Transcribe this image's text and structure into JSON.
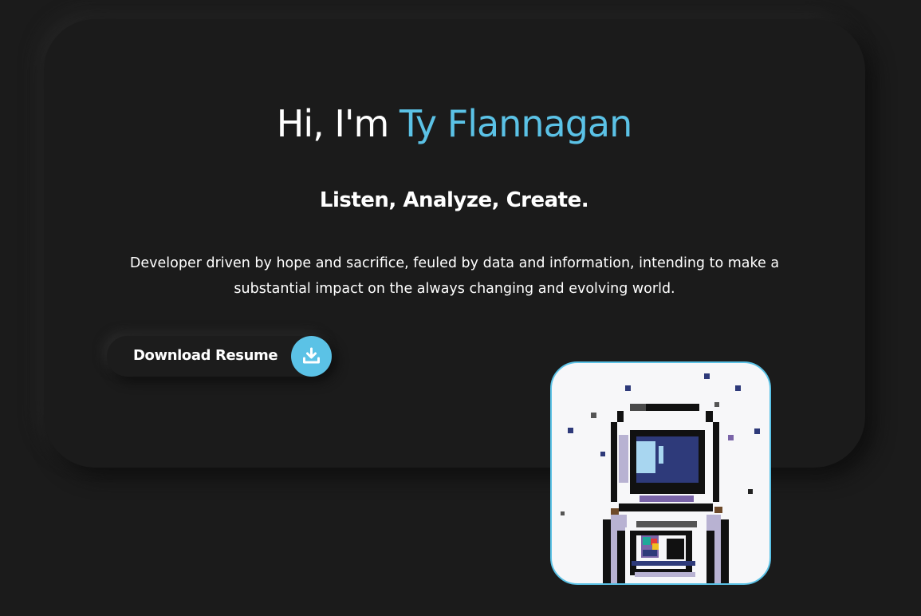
{
  "hero": {
    "greeting": "Hi, I'm ",
    "name": "Ty Flannagan",
    "tagline": "Listen, Analyze, Create.",
    "bio": "Developer driven by hope and sacrifice, feuled by data and information, intending to make a substantial impact on the always changing and evolving world."
  },
  "download": {
    "label": "Download Resume",
    "icon": "download-icon"
  },
  "avatar": {
    "icon": "astronaut-pixel-art"
  },
  "colors": {
    "background": "#1b1b1b",
    "accent": "#5bc2e6",
    "text": "#ffffff"
  }
}
